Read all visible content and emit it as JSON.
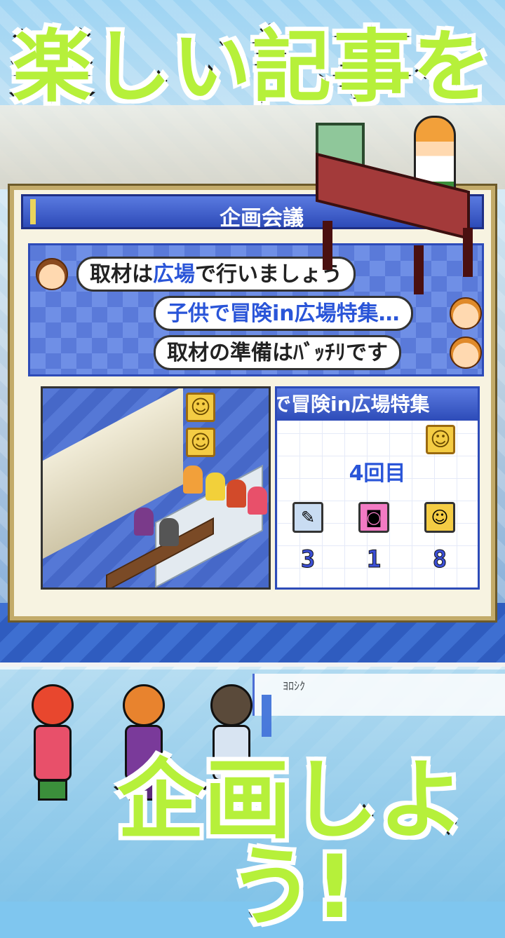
{
  "headline": "楽しい記事を",
  "dialog": {
    "title": "企画会議"
  },
  "conversation": [
    {
      "speaker_side": "left",
      "before": "取材は",
      "highlight": "広場",
      "after": "で行いましょう"
    },
    {
      "speaker_side": "right",
      "before": "",
      "highlight": "子供で冒険in広場特集…",
      "after": ""
    },
    {
      "speaker_side": "right",
      "before": "取材の準備は",
      "highlight": "",
      "after": "ﾊﾞｯﾁﾘです"
    }
  ],
  "stats_panel": {
    "title": "で冒険in広場特集",
    "round": "4回目",
    "items": [
      {
        "icon": "notepad-icon",
        "value": "3"
      },
      {
        "icon": "camera-icon",
        "value": "1"
      },
      {
        "icon": "smiley-icon",
        "value": "8"
      }
    ]
  },
  "bottom_ui": {
    "glyph_top": "ﾖﾛｼｸ",
    "glyph_mid": "ﾖﾛｼｸ"
  },
  "cta": "企画しよう!",
  "colors": {
    "headline_green": "#b6f03a",
    "panel_blue": "#2d4bb8",
    "highlight_blue": "#2a55d8",
    "stat_blue": "#3b4fd6"
  }
}
